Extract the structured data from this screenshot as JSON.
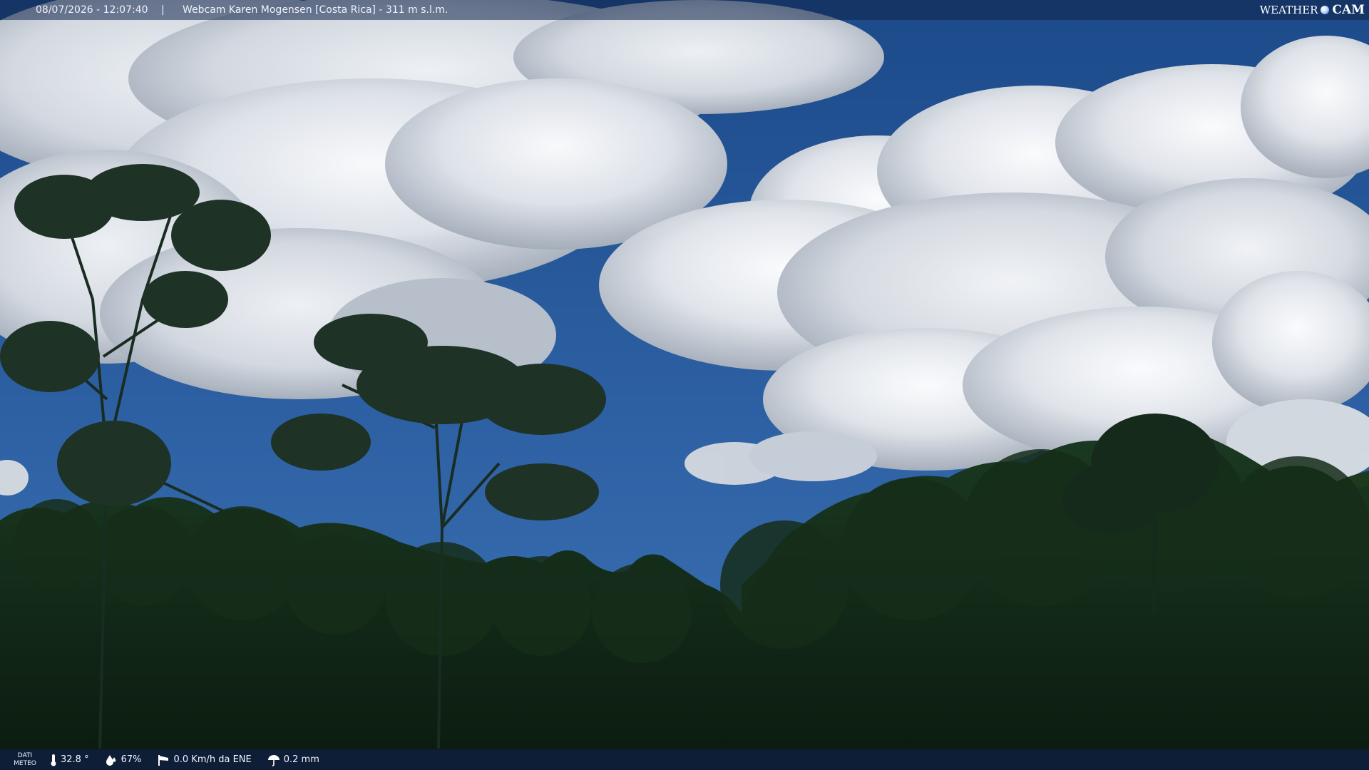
{
  "overlay": {
    "timestamp": "08/07/2026 - 12:07:40",
    "separator": "|",
    "title": "Webcam Karen Mogensen [Costa Rica]  - 311 m s.l.m.",
    "logo_word": "WEATHER",
    "logo_cam": "CAM"
  },
  "weather": {
    "label_line1": "DATI",
    "label_line2": "METEO",
    "temperature": "32.8 °",
    "humidity": "67%",
    "wind": "0.0 Km/h da ENE",
    "rain": "0.2 mm"
  },
  "icons": {
    "temperature": "thermometer-icon",
    "humidity": "drop-icon",
    "wind": "windsock-icon",
    "rain": "umbrella-icon"
  },
  "colors": {
    "sky_top": "#1e4e8f",
    "sky_bottom": "#3f76b6",
    "forest": "#0f2314"
  }
}
